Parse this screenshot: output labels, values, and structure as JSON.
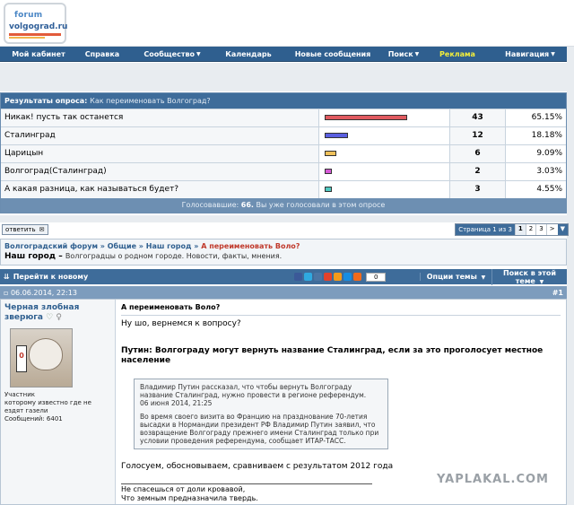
{
  "logo": {
    "line1": "forum",
    "line2": "volgograd.ru"
  },
  "nav": {
    "items": [
      {
        "label": "Мой кабинет",
        "arrow": false
      },
      {
        "label": "Справка",
        "arrow": false
      },
      {
        "label": "Сообщество",
        "arrow": true
      },
      {
        "label": "Календарь",
        "arrow": false
      },
      {
        "label": "Новые сообщения",
        "arrow": false
      },
      {
        "label": "Поиск",
        "arrow": true
      },
      {
        "label": "Реклама",
        "arrow": false,
        "highlight": "#f4ef3a"
      },
      {
        "label": "Навигация",
        "arrow": true
      }
    ]
  },
  "poll": {
    "title_label": "Результаты опроса:",
    "question": "Как переименовать Волгоград?",
    "options": [
      {
        "text": "Никак! пусть так останется",
        "votes": "43",
        "percent": "65.15%",
        "share": 0.6515,
        "color": "#e05a5f"
      },
      {
        "text": "Сталинград",
        "votes": "12",
        "percent": "18.18%",
        "share": 0.1818,
        "color": "#5a5fe0"
      },
      {
        "text": "Царицын",
        "votes": "6",
        "percent": "9.09%",
        "share": 0.0909,
        "color": "#f0c15a"
      },
      {
        "text": "Волгоград(Сталинград)",
        "votes": "2",
        "percent": "3.03%",
        "share": 0.0303,
        "color": "#d65ad6"
      },
      {
        "text": "А какая разница, как называться будет?",
        "votes": "3",
        "percent": "4.55%",
        "share": 0.0455,
        "color": "#4fc9c0"
      }
    ],
    "footer_label": "Голосовавшие:",
    "footer_count": "66.",
    "footer_note": "Вы уже голосовали в этом опросе"
  },
  "reply_button": "ответить",
  "pager": {
    "label": "Страница 1 из 3",
    "pages": [
      "1",
      "2",
      "3"
    ],
    "next": ">"
  },
  "breadcrumb": {
    "items": [
      "Волгоградский форум",
      "Общие",
      "Наш город"
    ],
    "current": "А переименовать Воло?",
    "section": "Наш город",
    "section_desc": "Волгоградцы о родном городе. Новости, факты, мнения."
  },
  "toolbar": {
    "goto_new": "Перейти к новому",
    "share_count": "0",
    "thread_options": "Опции темы",
    "search_thread": "Поиск в этой теме"
  },
  "post": {
    "date": "06.06.2014, 22:13",
    "number": "#1",
    "username": "Черная злобная зверюга",
    "avatar_sign": "0",
    "role_lines": [
      "Участник",
      "которому известно где не",
      "ездят газели",
      "Сообщений: 6401"
    ],
    "title": "А переименовать Воло?",
    "intro": "Ну шо, вернемся к вопросу?",
    "headline": "Путин: Волгограду могут вернуть название Сталинград, если за это проголосует местное население",
    "quote_p1": "Владимир Путин рассказал, что чтобы вернуть Волгограду название Сталинград, нужно провести в регионе референдум.",
    "quote_date": "06 июня 2014, 21:25",
    "quote_p2": "Во время своего визита во Францию на празднование 70-летия высадки в Нормандии президент РФ Владимир Путин заявил, что возвращение Волгограду прежнего имени Сталинград только при условии проведения референдума, сообщает ИТАР-ТАСС.",
    "closing": "Голосуем, обосновываем, сравниваем с результатом 2012 года",
    "signature_lines": [
      "Не спасешься от доли кровавой,",
      "Что земным предназначила твердь."
    ]
  },
  "watermark": "YAPLAKAL.COM"
}
